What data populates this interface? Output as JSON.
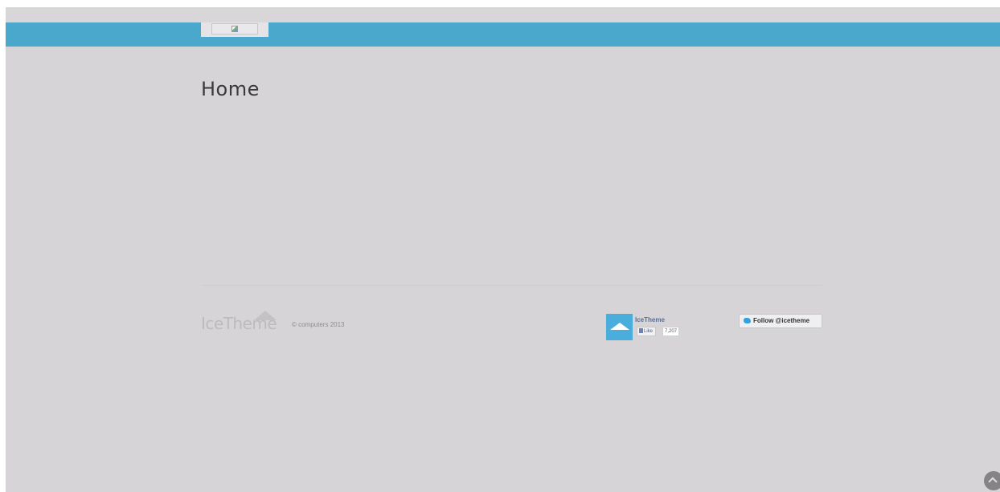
{
  "header": {
    "logo_alt": ""
  },
  "main": {
    "title": "Home"
  },
  "footer": {
    "logo_text": "IceTheme",
    "copyright": "© computers 2013",
    "facebook": {
      "page_name": "IceTheme",
      "like_label": "Like",
      "like_count": "7,207"
    },
    "twitter": {
      "follow_label": "Follow @icetheme"
    }
  },
  "icons": {
    "broken_image": "broken-image-icon",
    "mountain": "mountain-icon",
    "thumbs_up": "thumbs-up-icon",
    "twitter_bird": "twitter-bird-icon",
    "scroll_top": "chevron-up-icon"
  },
  "colors": {
    "topbar": "#4aa8cc",
    "background": "#d6d4d7",
    "facebook_avatar": "#4aaedc",
    "twitter_bird": "#2fa2df"
  }
}
